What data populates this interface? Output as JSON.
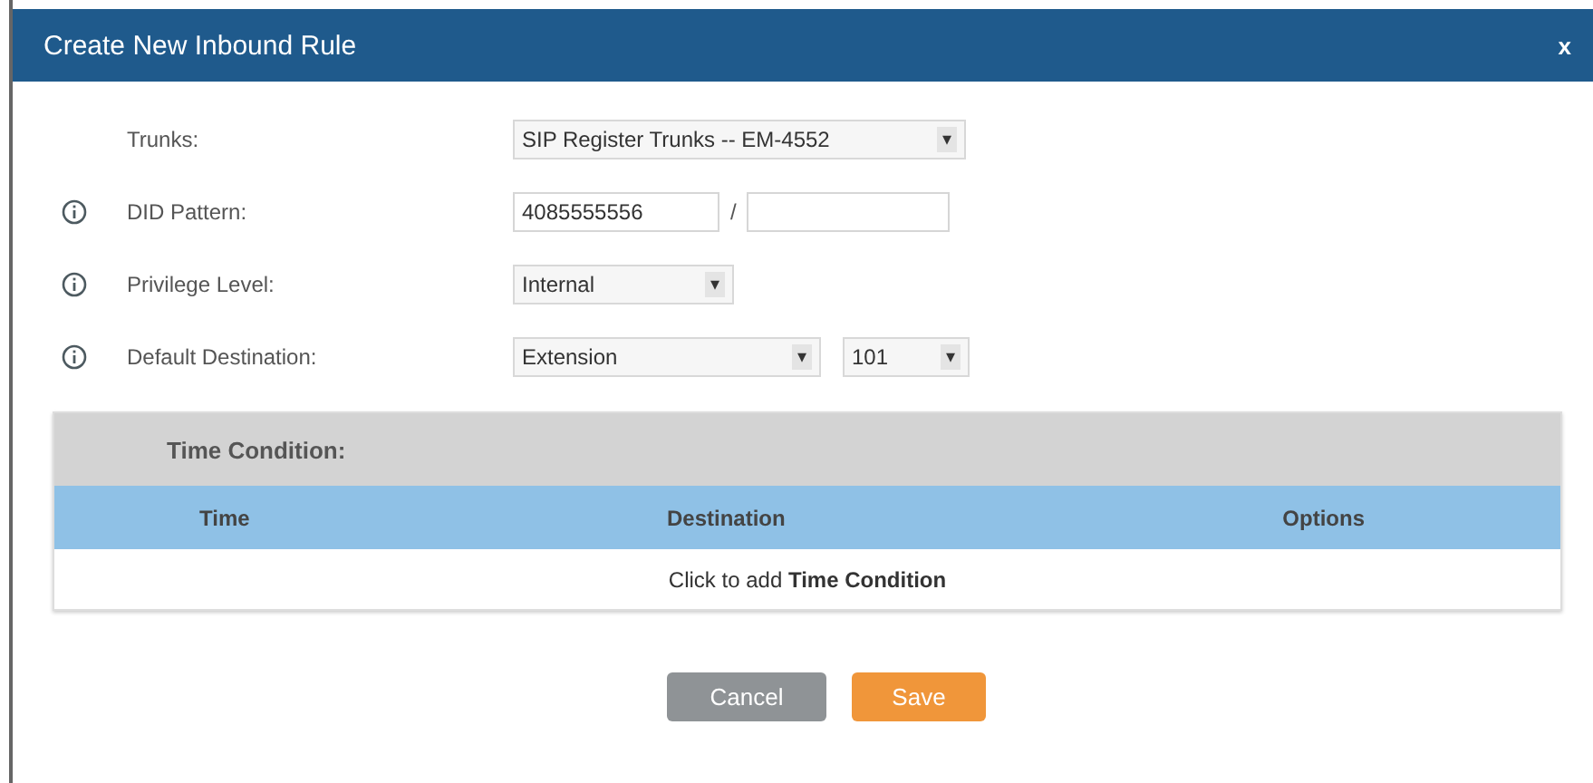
{
  "window": {
    "title": "Create New Inbound Rule",
    "close": "x"
  },
  "fields": [
    {
      "label": "Trunks:",
      "info": false,
      "kind": "select",
      "value": "SIP Register Trunks -- EM-4552",
      "caret": "▾"
    },
    {
      "label": "DID Pattern:",
      "info": true,
      "kind": "pattern",
      "value": "4085555556",
      "separator": "/"
    },
    {
      "label": "Privilege Level:",
      "info": true,
      "kind": "select",
      "value": "Internal",
      "caret": "▾"
    },
    {
      "label": "Default Destination:",
      "info": true,
      "kind": "select-pair",
      "value": "Extension",
      "caret": "▾",
      "value_2": "101",
      "caret_2": "▾"
    }
  ],
  "time_condition": {
    "title": "Time Condition:",
    "columns": [
      "Time",
      "Destination",
      "Options"
    ],
    "add_row": "Click to add **Time Condition**"
  },
  "buttons": [
    {
      "label": "Cancel",
      "kind": "secondary"
    },
    {
      "label": "Save",
      "kind": "primary"
    }
  ]
}
